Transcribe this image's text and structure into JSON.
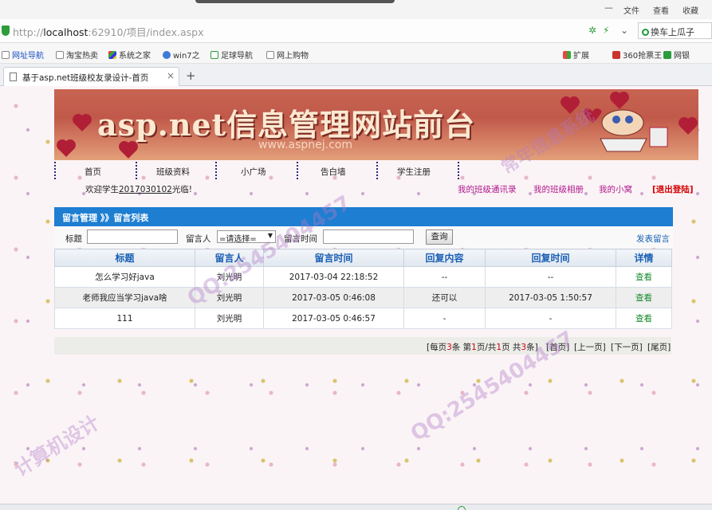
{
  "browser": {
    "menu": [
      "文件",
      "查看",
      "收藏"
    ],
    "minimize": "—",
    "url_prefix": "http://",
    "url_host": "localhost",
    "url_rest": ":62910/项目/index.aspx",
    "search_text": "换车上瓜子",
    "bookmarks": [
      "网址导航",
      "淘宝热卖",
      "系统之家",
      "win7之",
      "足球导航",
      "网上购物",
      "扩展",
      "360抢票王",
      "网银"
    ],
    "tab_title": "基于asp.net班级校友录设计-首页",
    "tab_close": "×",
    "new_tab": "+",
    "colors": {
      "accent": "#1e7ed1",
      "secure": "#2f9d3b"
    }
  },
  "banner": {
    "title": "asp.net信息管理网站前台",
    "url": "www.aspnej.com"
  },
  "nav": [
    "首页",
    "班级资料",
    "小广场",
    "告白墙",
    "学生注册"
  ],
  "welcome": {
    "prefix": "欢迎学生",
    "user": "2017030102",
    "suffix": "光临!"
  },
  "top_links": [
    "我的班级通讯录",
    "我的班级相册",
    "我的小窝"
  ],
  "logout": "[退出登陆]",
  "panel": {
    "title": "留言管理 》》留言列表"
  },
  "filter": {
    "title_label": "标题",
    "author_label": "留言人",
    "author_select": "=请选择=",
    "time_label": "留言时间",
    "search_button": "查询",
    "post_link": "发表留言"
  },
  "table": {
    "headers": [
      "标题",
      "留言人",
      "留言时间",
      "回复内容",
      "回复时间",
      "详情"
    ],
    "rows": [
      [
        "怎么学习好java",
        "刘光明",
        "2017-03-04 22:18:52",
        "--",
        "--",
        "查看"
      ],
      [
        "老师我应当学习java啥",
        "刘光明",
        "2017-03-05 0:46:08",
        "还可以",
        "2017-03-05 1:50:57",
        "查看"
      ],
      [
        "111",
        "刘光明",
        "2017-03-05 0:46:57",
        "-",
        "-",
        "查看"
      ]
    ]
  },
  "pager": {
    "info_a": "[每页",
    "per_page": "3",
    "info_b": "条 第",
    "page": "1",
    "info_c": "页/共",
    "total_pages": "1",
    "info_d": "页 共",
    "total": "3",
    "info_e": "条]",
    "first": "[首页]",
    "prev": "[上一页]",
    "next": "[下一页]",
    "last": "[尾页]"
  },
  "watermarks": [
    "QQ:2545404457",
    "计算机设计",
    "常年信息系统"
  ]
}
